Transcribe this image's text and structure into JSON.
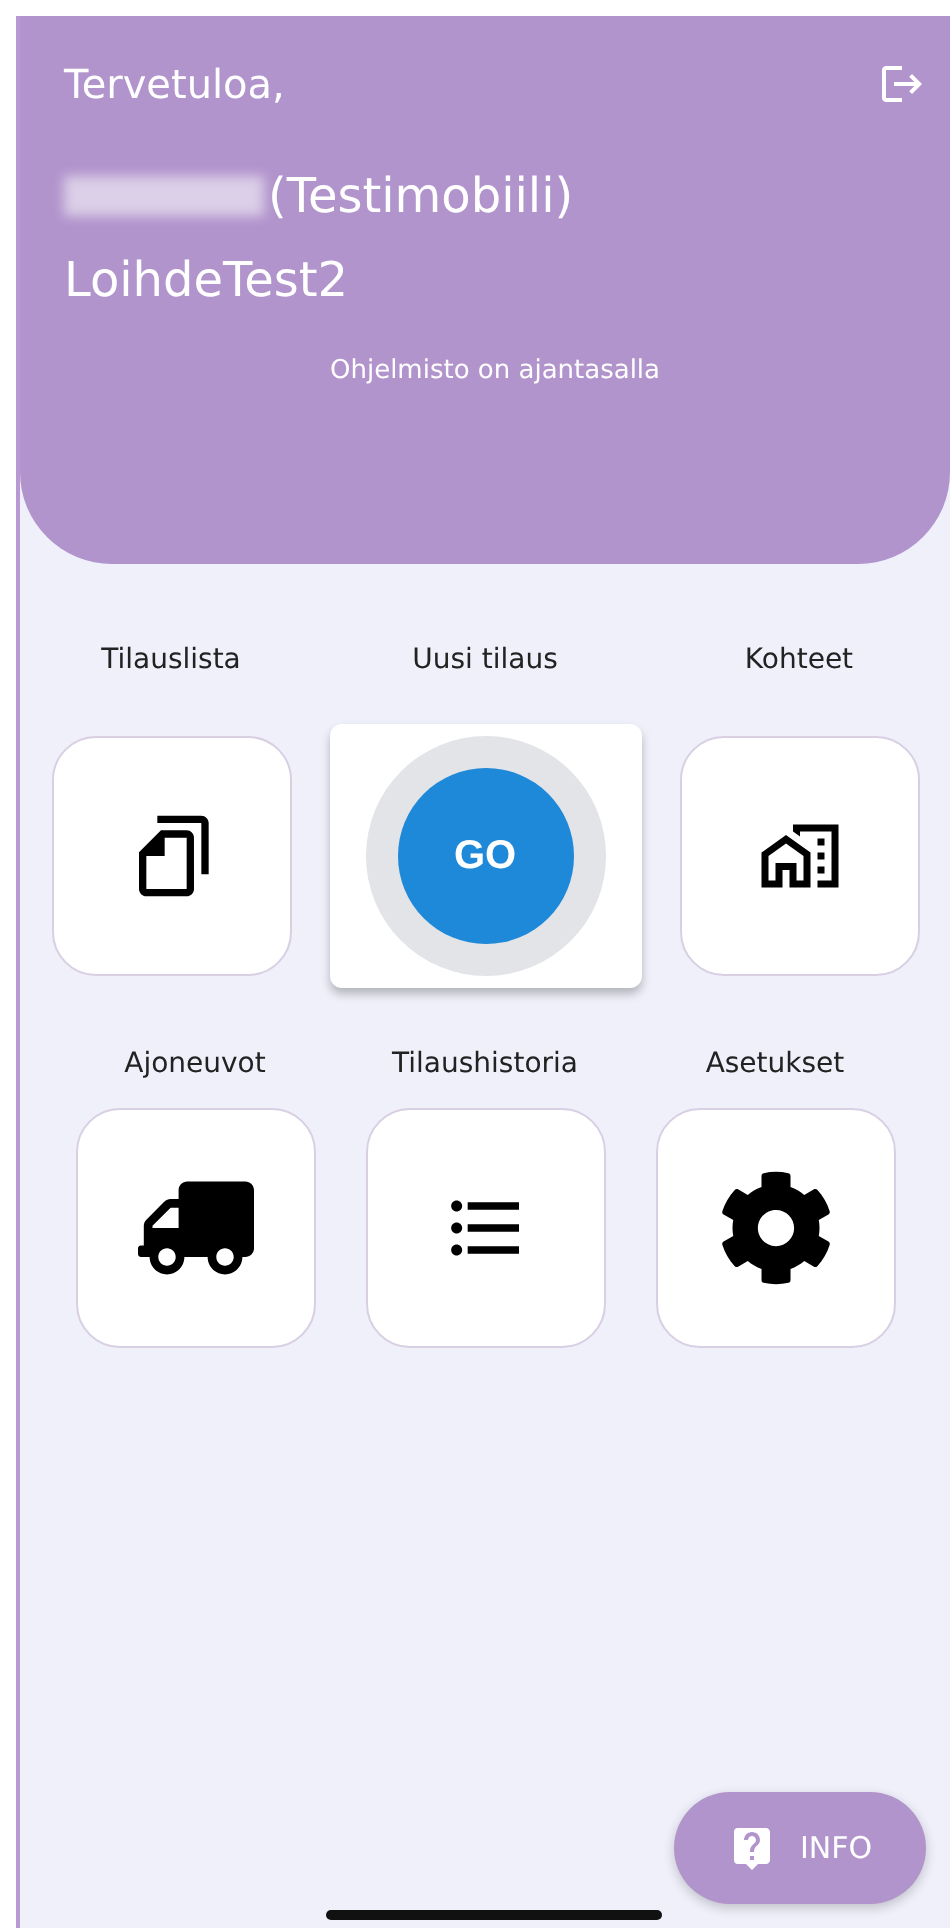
{
  "header": {
    "greeting": "Tervetuloa,",
    "user": "(Testimobiili)",
    "site": "LoihdeTest2",
    "status": "Ohjelmisto on ajantasalla"
  },
  "rows": [
    [
      {
        "label": "Tilauslista",
        "kind": "tile"
      },
      {
        "label": "Uusi tilaus",
        "kind": "go",
        "button": "GO"
      },
      {
        "label": "Kohteet",
        "kind": "tile"
      }
    ],
    [
      {
        "label": "Ajoneuvot",
        "kind": "tile"
      },
      {
        "label": "Tilaushistoria",
        "kind": "tile"
      },
      {
        "label": "Asetukset",
        "kind": "tile"
      }
    ]
  ],
  "info_button": "INFO"
}
